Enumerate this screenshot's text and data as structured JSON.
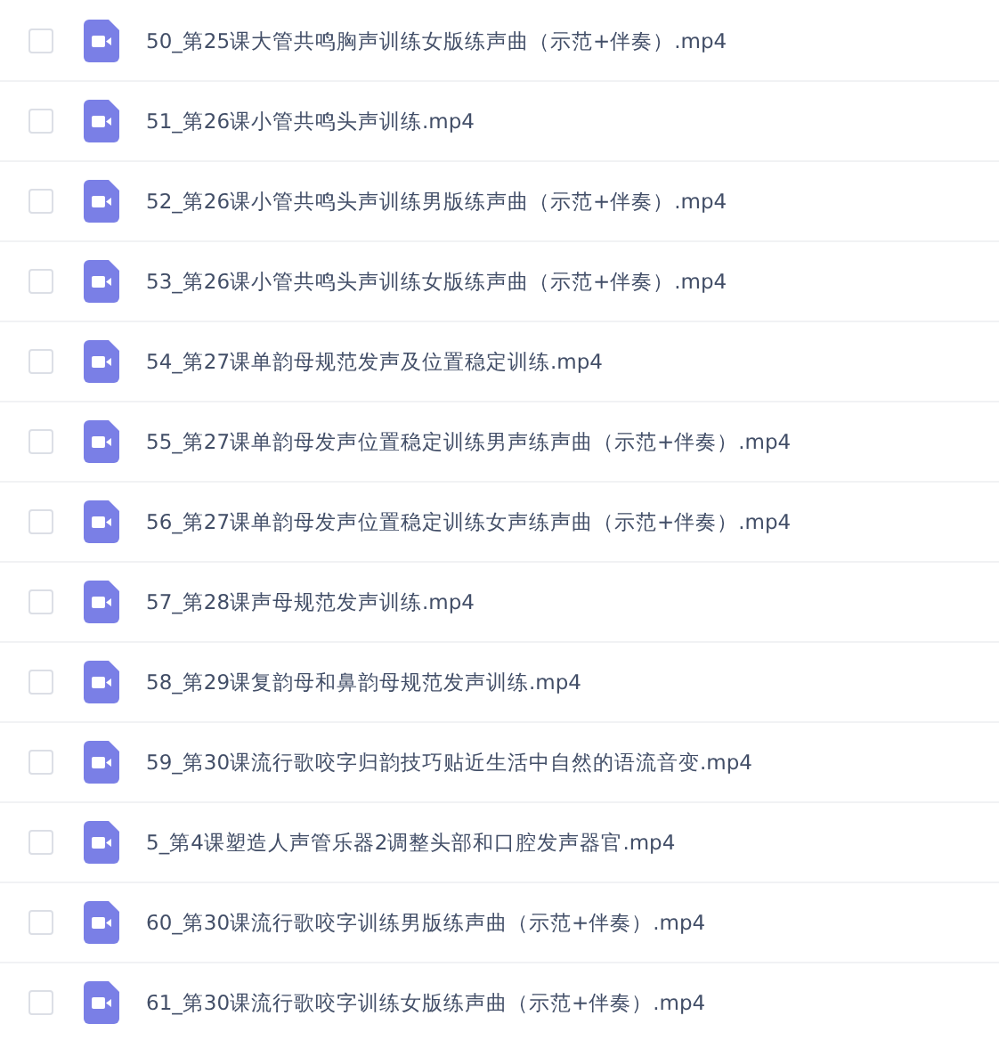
{
  "files": [
    {
      "name": "50_第25课大管共鸣胸声训练女版练声曲（示范+伴奏）.mp4",
      "checked": false
    },
    {
      "name": "51_第26课小管共鸣头声训练.mp4",
      "checked": false
    },
    {
      "name": "52_第26课小管共鸣头声训练男版练声曲（示范+伴奏）.mp4",
      "checked": false
    },
    {
      "name": "53_第26课小管共鸣头声训练女版练声曲（示范+伴奏）.mp4",
      "checked": false
    },
    {
      "name": "54_第27课单韵母规范发声及位置稳定训练.mp4",
      "checked": false
    },
    {
      "name": "55_第27课单韵母发声位置稳定训练男声练声曲（示范+伴奏）.mp4",
      "checked": false
    },
    {
      "name": "56_第27课单韵母发声位置稳定训练女声练声曲（示范+伴奏）.mp4",
      "checked": false
    },
    {
      "name": "57_第28课声母规范发声训练.mp4",
      "checked": false
    },
    {
      "name": "58_第29课复韵母和鼻韵母规范发声训练.mp4",
      "checked": false
    },
    {
      "name": "59_第30课流行歌咬字归韵技巧贴近生活中自然的语流音变.mp4",
      "checked": false
    },
    {
      "name": "5_第4课塑造人声管乐器2调整头部和口腔发声器官.mp4",
      "checked": false
    },
    {
      "name": "60_第30课流行歌咬字训练男版练声曲（示范+伴奏）.mp4",
      "checked": false
    },
    {
      "name": "61_第30课流行歌咬字训练女版练声曲（示范+伴奏）.mp4",
      "checked": false
    }
  ]
}
